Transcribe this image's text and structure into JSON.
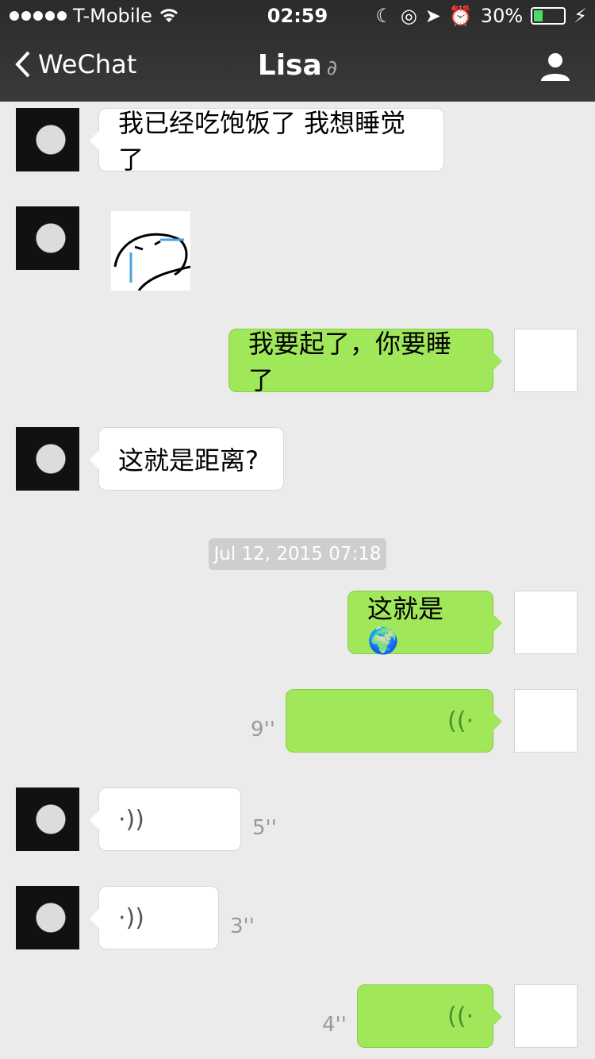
{
  "status_bar": {
    "carrier": "T-Mobile",
    "time": "02:59",
    "battery": "30%",
    "battery_level": 0.3
  },
  "nav": {
    "back_label": "WeChat",
    "title": "Lisa"
  },
  "messages": {
    "m1": {
      "text": "我已经吃饱饭了 我想睡觉了"
    },
    "m3": {
      "text": "我要起了，你要睡了"
    },
    "m4": {
      "text": "这就是距离?"
    },
    "timestamp": "Jul 12, 2015 07:18",
    "m5": {
      "text": "这就是🌍"
    },
    "m6": {
      "duration": "9''"
    },
    "m7": {
      "duration": "5''"
    },
    "m8": {
      "duration": "3''"
    },
    "m9": {
      "duration": "4''"
    }
  },
  "icons": {
    "back": "chevron-left-icon",
    "profile": "person-icon",
    "ear": "ear-icon",
    "voice": "voice-wave-icon"
  },
  "colors": {
    "header": "#333333",
    "bubble_out": "#a0e75a",
    "bubble_in": "#ffffff",
    "background": "#ebebeb"
  }
}
